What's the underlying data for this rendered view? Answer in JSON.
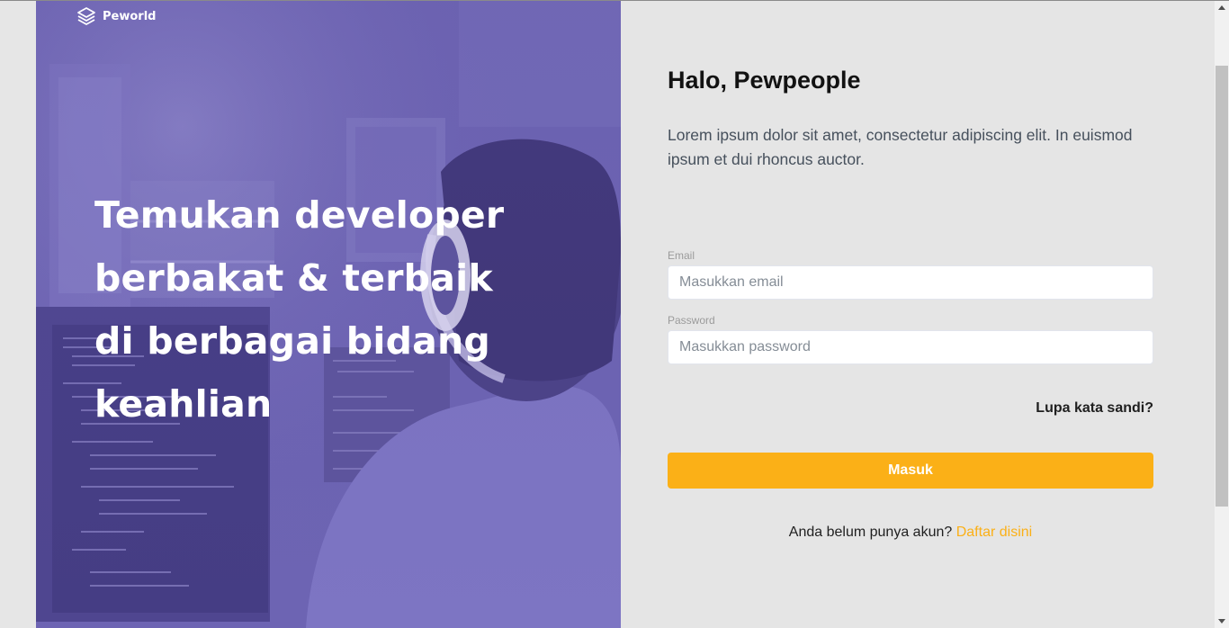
{
  "brand": {
    "name": "Peworld",
    "icon": "layers-icon"
  },
  "hero": {
    "headline": "Temukan developer berbakat & terbaik di berbagai bidang keahlian",
    "background": "developer-with-headphones-photo",
    "overlay_color": "#6b62b1"
  },
  "form": {
    "greeting": "Halo, Pewpeople",
    "intro": "Lorem ipsum dolor sit amet, consectetur adipiscing elit. In euismod ipsum et dui rhoncus auctor.",
    "email_label": "Email",
    "email_placeholder": "Masukkan email",
    "password_label": "Password",
    "password_placeholder": "Masukkan password",
    "forgot_label": "Lupa kata sandi?",
    "submit_label": "Masuk",
    "register_prompt": "Anda belum punya akun?",
    "register_link": "Daftar disini"
  },
  "colors": {
    "accent": "#fbb017",
    "hero_purple": "#6b62b1",
    "panel_bg": "#e5e5e5"
  }
}
